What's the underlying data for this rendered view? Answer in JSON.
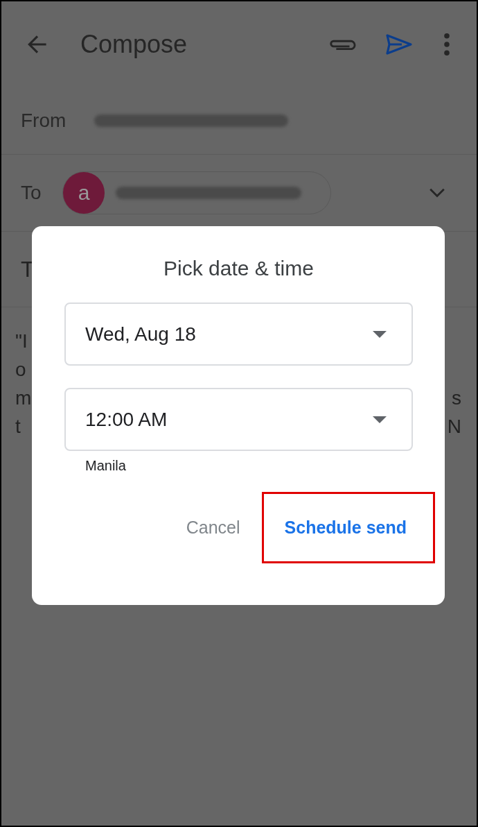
{
  "compose": {
    "title": "Compose",
    "from_label": "From",
    "to_label": "To",
    "recipients": [
      {
        "initial": "a",
        "color": "#6e1a3a"
      }
    ],
    "subject": "T",
    "body_lines": [
      {
        "left": "\"I"
      },
      {
        "left": "o"
      },
      {
        "left": "m",
        "right": "s"
      },
      {
        "left": "t",
        "right": "N"
      }
    ]
  },
  "dialog": {
    "title": "Pick date & time",
    "fields": [
      {
        "value": "Wed, Aug 18"
      },
      {
        "value": "12:00 AM"
      }
    ],
    "timezone": "Manila",
    "buttons": [
      {
        "label": "Cancel",
        "kind": "secondary",
        "highlighted": false
      },
      {
        "label": "Schedule send",
        "kind": "primary",
        "highlighted": true
      }
    ]
  }
}
